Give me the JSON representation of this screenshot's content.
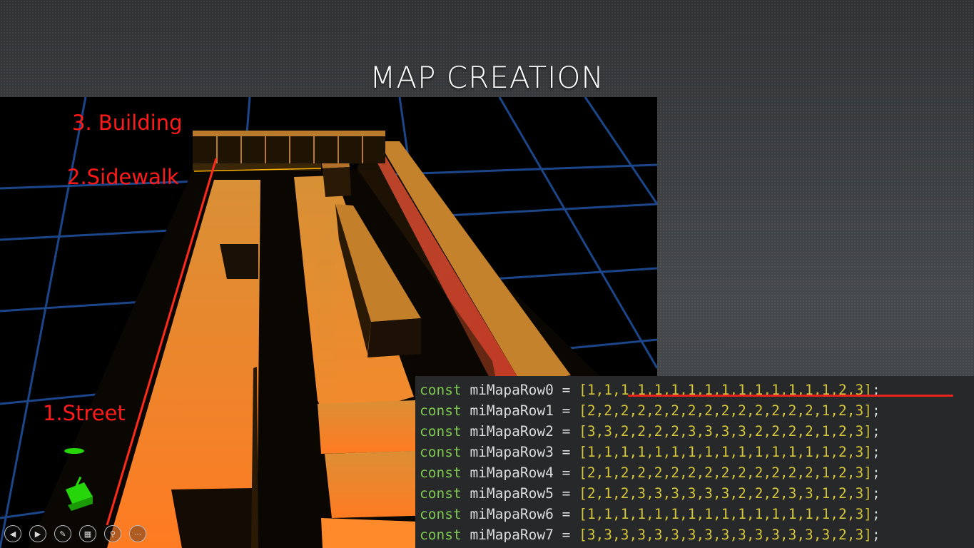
{
  "slide": {
    "title": "MAP CREATION"
  },
  "labels": {
    "building": "3. Building",
    "sidewalk": "2.Sidewalk",
    "street": "1.Street"
  },
  "code": {
    "lines": [
      {
        "keyword": "const",
        "name": "miMapaRow0",
        "op": "=",
        "array": "[1,1,1,1,1,1,1,1,1,1,1,1,1,1,1,2,3]",
        "end": ";"
      },
      {
        "keyword": "const",
        "name": "miMapaRow1",
        "op": "=",
        "array": "[2,2,2,2,2,2,2,2,2,2,2,2,2,2,1,2,3]",
        "end": ";"
      },
      {
        "keyword": "const",
        "name": "miMapaRow2",
        "op": "=",
        "array": "[3,3,2,2,2,2,3,3,3,3,2,2,2,2,1,2,3]",
        "end": ";"
      },
      {
        "keyword": "const",
        "name": "miMapaRow3",
        "op": "=",
        "array": "[1,1,1,1,1,1,1,1,1,1,1,1,1,1,1,2,3]",
        "end": ";"
      },
      {
        "keyword": "const",
        "name": "miMapaRow4",
        "op": "=",
        "array": "[2,1,2,2,2,2,2,2,2,2,2,2,2,2,1,2,3]",
        "end": ";"
      },
      {
        "keyword": "const",
        "name": "miMapaRow5",
        "op": "=",
        "array": "[2,1,2,3,3,3,3,3,3,2,2,2,3,3,1,2,3]",
        "end": ";"
      },
      {
        "keyword": "const",
        "name": "miMapaRow6",
        "op": "=",
        "array": "[1,1,1,1,1,1,1,1,1,1,1,1,1,1,1,2,3]",
        "end": ";"
      },
      {
        "keyword": "const",
        "name": "miMapaRow7",
        "op": "=",
        "array": "[3,3,3,3,3,3,3,3,3,3,3,3,3,3,3,2,3]",
        "end": ";"
      }
    ]
  },
  "toolbar": {
    "buttons": [
      {
        "name": "previous-slide-button",
        "icon": "chevron-left-icon",
        "glyph": "◀"
      },
      {
        "name": "next-slide-button",
        "icon": "chevron-right-icon",
        "glyph": "▶"
      },
      {
        "name": "pen-tool-button",
        "icon": "pen-icon",
        "glyph": "✎"
      },
      {
        "name": "see-all-slides-button",
        "icon": "grid-icon",
        "glyph": "▦"
      },
      {
        "name": "zoom-button",
        "icon": "magnifier-icon",
        "glyph": "⚲"
      },
      {
        "name": "more-options-button",
        "icon": "ellipsis-icon",
        "glyph": "⋯"
      }
    ]
  },
  "colors": {
    "street": "#ff7b22",
    "building_top": "#c98a2e",
    "building_side": "#2a1a05",
    "grid": "#1f4f9a",
    "label": "#ff1a1a",
    "code_keyword": "#7ec850",
    "code_array": "#d4c53a"
  }
}
